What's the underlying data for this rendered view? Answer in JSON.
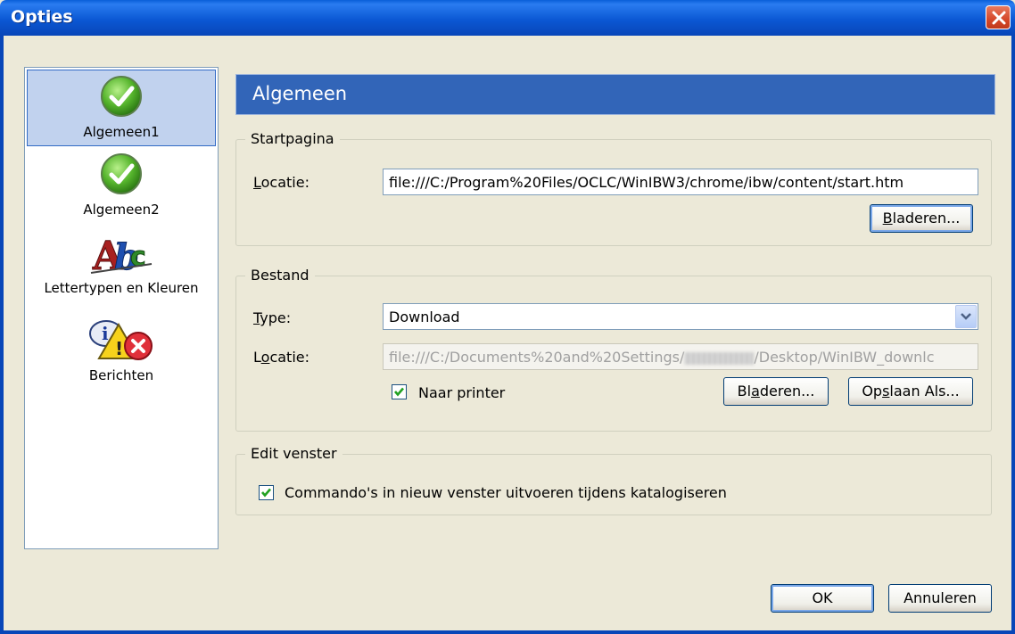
{
  "window": {
    "title": "Opties"
  },
  "sidebar": {
    "items": [
      {
        "label": "Algemeen1",
        "icon": "check-circle-icon",
        "selected": true
      },
      {
        "label": "Algemeen2",
        "icon": "check-circle-icon",
        "selected": false
      },
      {
        "label": "Lettertypen en Kleuren",
        "icon": "abc-fonts-icon",
        "selected": false
      },
      {
        "label": "Berichten",
        "icon": "info-warning-error-icon",
        "selected": false
      }
    ]
  },
  "pane": {
    "title": "Algemeen"
  },
  "startpagina": {
    "legend": "Startpagina",
    "location_label": "Locatie:",
    "location_value": "file:///C:/Program%20Files/OCLC/WinIBW3/chrome/ibw/content/start.htm",
    "browse_label": "Bladeren..."
  },
  "bestand": {
    "legend": "Bestand",
    "type_label": "Type:",
    "type_value": "Download",
    "location_label": "Locatie:",
    "location_prefix": "file:///C:/Documents%20and%20Settings/",
    "location_suffix": "/Desktop/WinIBW_downlc",
    "printer_label": "Naar printer",
    "printer_checked": true,
    "browse_label": "Bladeren...",
    "save_as_label": "Opslaan Als..."
  },
  "edit_venster": {
    "legend": "Edit venster",
    "commands_label": "Commando's in nieuw venster uitvoeren tijdens katalogiseren",
    "commands_checked": true
  },
  "footer": {
    "ok_label": "OK",
    "cancel_label": "Annuleren"
  }
}
